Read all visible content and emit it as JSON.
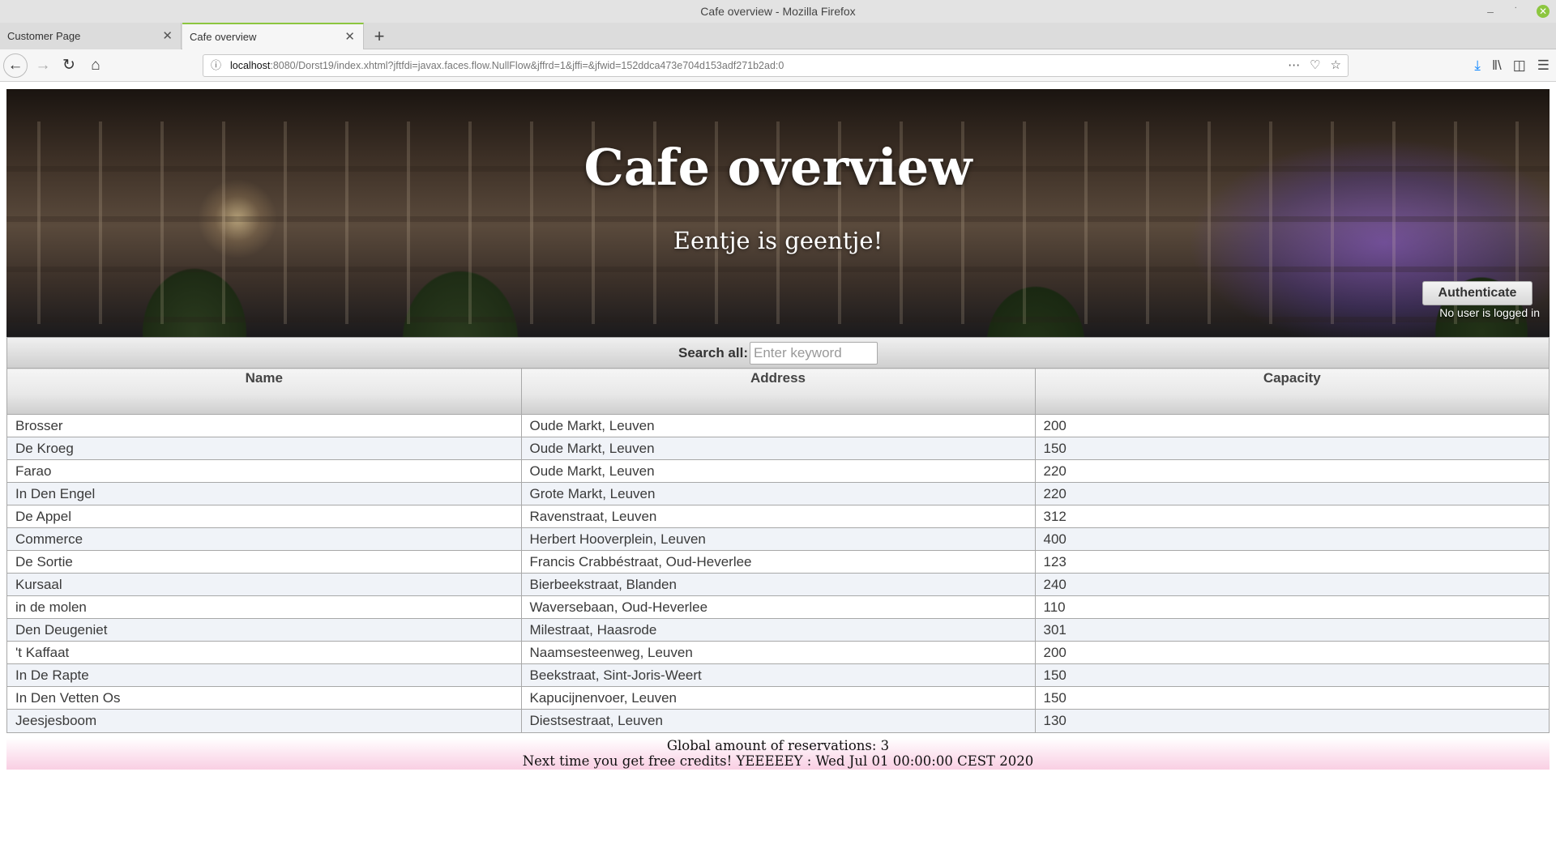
{
  "window": {
    "title": "Cafe overview - Mozilla Firefox"
  },
  "tabs": [
    {
      "label": "Customer Page",
      "active": false
    },
    {
      "label": "Cafe overview",
      "active": true
    }
  ],
  "urlbar": {
    "host": "localhost",
    "rest": ":8080/Dorst19/index.xhtml?jftfdi=javax.faces.flow.NullFlow&jffrd=1&jffi=&jfwid=152ddca473e704d153adf271b2ad:0"
  },
  "header": {
    "title": "Cafe overview",
    "subtitle": "Eentje is geentje!",
    "auth_button": "Authenticate",
    "auth_status": "No user is logged in"
  },
  "search": {
    "label": "Search all:",
    "placeholder": "Enter keyword",
    "value": ""
  },
  "table": {
    "columns": [
      "Name",
      "Address",
      "Capacity"
    ],
    "rows": [
      [
        "Brosser",
        "Oude Markt, Leuven",
        "200"
      ],
      [
        "De Kroeg",
        "Oude Markt, Leuven",
        "150"
      ],
      [
        "Farao",
        "Oude Markt, Leuven",
        "220"
      ],
      [
        "In Den Engel",
        "Grote Markt, Leuven",
        "220"
      ],
      [
        "De Appel",
        "Ravenstraat, Leuven",
        "312"
      ],
      [
        "Commerce",
        "Herbert Hooverplein, Leuven",
        "400"
      ],
      [
        "De Sortie",
        "Francis Crabbéstraat, Oud-Heverlee",
        "123"
      ],
      [
        "Kursaal",
        "Bierbeekstraat, Blanden",
        "240"
      ],
      [
        "in de molen",
        "Waversebaan, Oud-Heverlee",
        "110"
      ],
      [
        "Den Deugeniet",
        "Milestraat, Haasrode",
        "301"
      ],
      [
        "'t Kaffaat",
        "Naamsesteenweg, Leuven",
        "200"
      ],
      [
        "In De Rapte",
        "Beekstraat, Sint-Joris-Weert",
        "150"
      ],
      [
        "In Den Vetten Os",
        "Kapucijnenvoer, Leuven",
        "150"
      ],
      [
        "Jeesjesboom",
        "Diestsestraat, Leuven",
        "130"
      ]
    ]
  },
  "footer": {
    "reservations": "Global amount of reservations: 3",
    "credits": "Next time you get free credits! YEEEEEY : Wed Jul 01 00:00:00 CEST 2020"
  },
  "icons": {
    "minimize": "minimize-icon",
    "maximize": "maximize-icon",
    "close": "window-close-icon",
    "back": "back-arrow-icon",
    "forward": "forward-arrow-icon",
    "reload": "reload-icon",
    "home": "home-icon",
    "info": "info-icon",
    "more": "more-dots-icon",
    "pocket": "pocket-icon",
    "bookmark": "star-icon",
    "download": "download-icon",
    "library": "library-icon",
    "sidebar": "sidebar-icon",
    "menu": "hamburger-menu-icon"
  },
  "colors": {
    "accent": "#8cc63f",
    "row_alt": "#f0f3f8",
    "footer_pink": "#f9cfe3"
  }
}
